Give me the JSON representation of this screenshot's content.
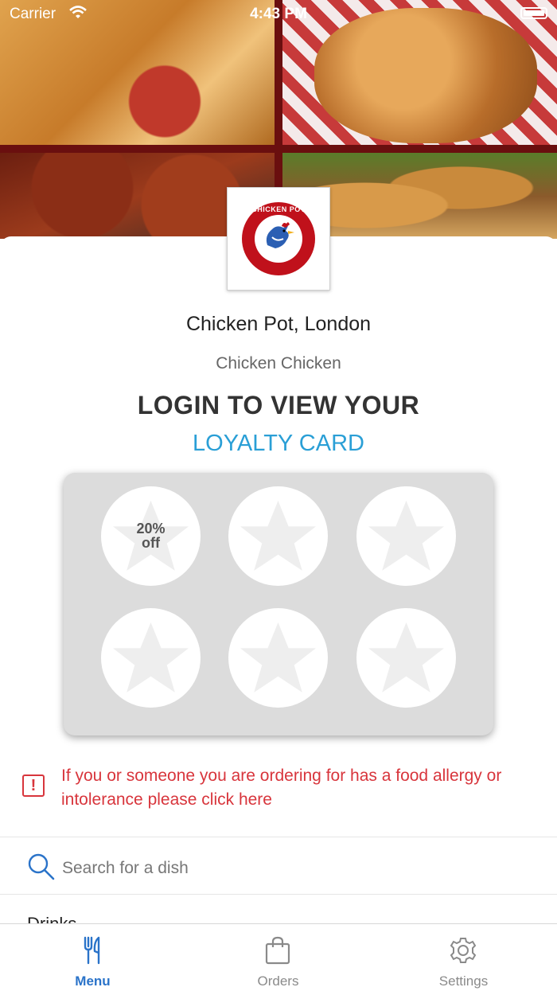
{
  "status_bar": {
    "carrier": "Carrier",
    "time": "4:43 PM"
  },
  "logo": {
    "text": "CHICKEN POT"
  },
  "restaurant": {
    "name": "Chicken Pot, London",
    "subtitle": "Chicken Chicken"
  },
  "loyalty": {
    "title": "LOGIN TO VIEW YOUR",
    "link": "LOYALTY CARD",
    "stamps": [
      {
        "label_line1": "20%",
        "label_line2": "off"
      },
      {
        "label_line1": "",
        "label_line2": ""
      },
      {
        "label_line1": "",
        "label_line2": ""
      },
      {
        "label_line1": "",
        "label_line2": ""
      },
      {
        "label_line1": "",
        "label_line2": ""
      },
      {
        "label_line1": "",
        "label_line2": ""
      }
    ]
  },
  "allergy": {
    "text": "If you or someone you are ordering for has a food allergy or intolerance please click here"
  },
  "search": {
    "placeholder": "Search for a dish",
    "value": ""
  },
  "category_peek": "Drinks",
  "tabs": [
    {
      "label": "Menu",
      "icon": "fork-knife-icon",
      "active": true
    },
    {
      "label": "Orders",
      "icon": "shopping-bag-icon",
      "active": false
    },
    {
      "label": "Settings",
      "icon": "gear-icon",
      "active": false
    }
  ],
  "colors": {
    "accent": "#2a9fd6",
    "tab_active": "#2a73c9",
    "alert": "#d8353c",
    "brand_red": "#c0111b"
  }
}
